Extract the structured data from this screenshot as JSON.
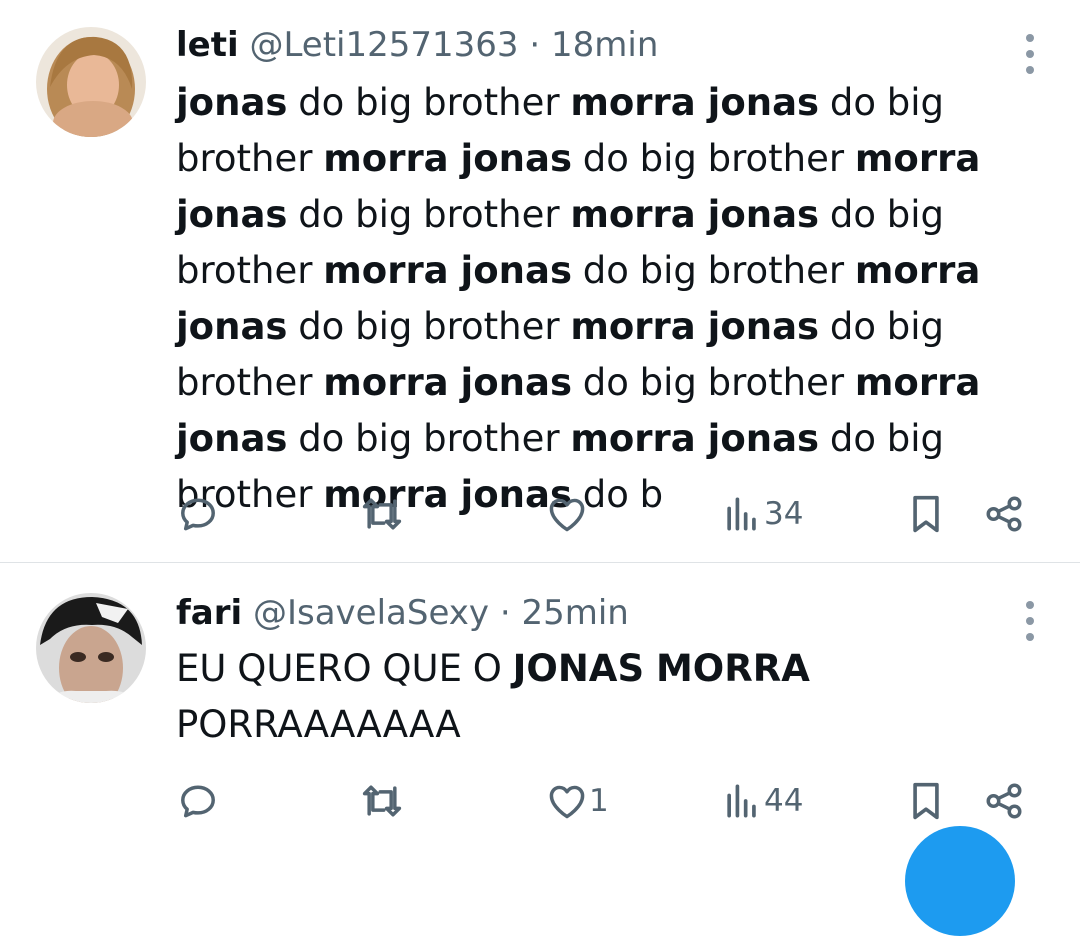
{
  "tweets": [
    {
      "name": "leti",
      "handle": "@Leti12571363",
      "separator": "·",
      "time": "18min",
      "segments": [
        {
          "text": "jonas",
          "bold": true
        },
        {
          "text": " do big brother ",
          "bold": false
        },
        {
          "text": "morra jonas",
          "bold": true
        },
        {
          "text": " do big brother ",
          "bold": false
        },
        {
          "text": "morra jonas",
          "bold": true
        },
        {
          "text": " do big brother ",
          "bold": false
        },
        {
          "text": "morra jonas",
          "bold": true
        },
        {
          "text": " do big brother ",
          "bold": false
        },
        {
          "text": "morra jonas",
          "bold": true
        },
        {
          "text": " do big brother ",
          "bold": false
        },
        {
          "text": "morra jonas",
          "bold": true
        },
        {
          "text": " do big brother ",
          "bold": false
        },
        {
          "text": "morra jonas",
          "bold": true
        },
        {
          "text": " do big brother ",
          "bold": false
        },
        {
          "text": "morra jonas",
          "bold": true
        },
        {
          "text": " do big brother ",
          "bold": false
        },
        {
          "text": "morra jonas",
          "bold": true
        },
        {
          "text": " do big brother ",
          "bold": false
        },
        {
          "text": "morra jonas",
          "bold": true
        },
        {
          "text": " do big brother ",
          "bold": false
        },
        {
          "text": "morra jonas",
          "bold": true
        },
        {
          "text": " do big brother ",
          "bold": false
        },
        {
          "text": "morra jonas",
          "bold": true
        },
        {
          "text": " do b",
          "bold": false
        }
      ],
      "actions": {
        "reply": "",
        "retweet": "",
        "like": "",
        "views": "34"
      }
    },
    {
      "name": "fari",
      "handle": "@IsavelaSexy",
      "separator": "·",
      "time": "25min",
      "segments": [
        {
          "text": "EU QUERO QUE O ",
          "bold": false
        },
        {
          "text": "JONAS MORRA",
          "bold": true
        },
        {
          "text": " PORRAAAAAAA",
          "bold": false
        }
      ],
      "actions": {
        "reply": "",
        "retweet": "",
        "like": "1",
        "views": "44"
      }
    }
  ],
  "colors": {
    "text": "#0f1419",
    "secondary": "#536471",
    "divider": "#dfe3e6",
    "accent": "#1d9bf0"
  },
  "icons": [
    "reply-icon",
    "retweet-icon",
    "like-icon",
    "views-icon",
    "bookmark-icon",
    "share-icon",
    "more-icon"
  ]
}
